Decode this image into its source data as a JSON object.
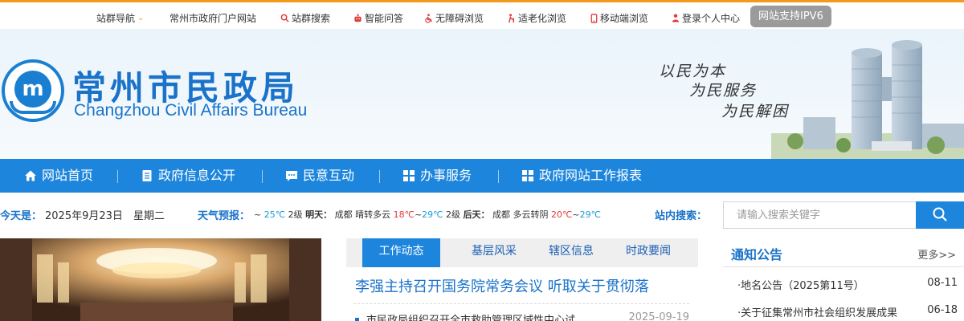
{
  "topbar": {
    "items": [
      {
        "label": "站群导航",
        "icon": "chevron-down-icon"
      },
      {
        "label": "常州市政府门户网站",
        "icon": ""
      },
      {
        "label": "站群搜索",
        "icon": "search-icon"
      },
      {
        "label": "智能问答",
        "icon": "robot-icon"
      },
      {
        "label": "无障碍浏览",
        "icon": "wheelchair-icon"
      },
      {
        "label": "适老化浏览",
        "icon": "elderly-icon"
      },
      {
        "label": "移动端浏览",
        "icon": "mobile-icon"
      },
      {
        "label": "登录个人中心",
        "icon": "user-icon"
      }
    ],
    "ipv6": "网站支持IPV6"
  },
  "banner": {
    "title": "常州市民政局",
    "subtitle": "Changzhou Civil Affairs Bureau",
    "slogans": [
      "以民为本",
      "为民服务",
      "为民解困"
    ]
  },
  "nav": {
    "items": [
      {
        "label": "网站首页",
        "icon": "home-icon"
      },
      {
        "label": "政府信息公开",
        "icon": "document-icon"
      },
      {
        "label": "民意互动",
        "icon": "chat-icon"
      },
      {
        "label": "办事服务",
        "icon": "grid-icon"
      },
      {
        "label": "政府网站工作报表",
        "icon": "grid-icon"
      }
    ]
  },
  "info": {
    "today_label": "今天是：",
    "date": "2025年9月23日",
    "weekday": "星期二",
    "weather_label": "天气预报：",
    "weather": {
      "today_range_sep": "~",
      "today_low": "25℃",
      "today_wind": "2级",
      "tomorrow_label": "明天：",
      "tomorrow_city": "成都",
      "tomorrow_cond": "晴转多云",
      "tomorrow_high": "18℃",
      "tomorrow_sep": "~",
      "tomorrow_low": "29℃",
      "tomorrow_wind": "2级",
      "after_label": "后天：",
      "after_city": "成都",
      "after_cond": "多云转阴",
      "after_high": "20℃",
      "after_sep": "~",
      "after_low": "29℃"
    },
    "search_label": "站内搜索：",
    "search_placeholder": "请输入搜索关键字"
  },
  "news": {
    "tabs": [
      "工作动态",
      "基层风采",
      "辖区信息",
      "时政要闻"
    ],
    "active_tab": 0,
    "headline": "李强主持召开国务院常务会议 听取关于贯彻落",
    "items": [
      {
        "title": "市民政局组织召开全市救助管理区域性中心试",
        "date": "2025-09-19"
      }
    ]
  },
  "notice": {
    "title": "通知公告",
    "more": "更多>>",
    "items": [
      {
        "title": "·地名公告（2025第11号）",
        "date": "08-11"
      },
      {
        "title": "·关于征集常州市社会组织发展成果",
        "date": "06-18"
      }
    ]
  },
  "colors": {
    "brand_blue": "#1d86dc",
    "accent_orange": "#f39a1e",
    "alert_red": "#e23b3b"
  }
}
